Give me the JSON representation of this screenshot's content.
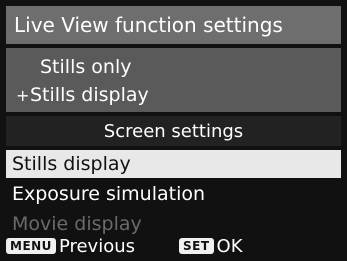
{
  "title": "Live View function settings",
  "options": {
    "line1": "Stills only",
    "line2": "Stills display",
    "cursor_glyph": "+"
  },
  "screen_settings": {
    "header": "Screen settings",
    "items": [
      {
        "label": "Stills display",
        "state": "selected"
      },
      {
        "label": "Exposure simulation",
        "state": "normal"
      },
      {
        "label": "Movie display",
        "state": "disabled"
      }
    ]
  },
  "footer": {
    "menu_key": "MENU",
    "menu_label": "Previous",
    "set_key": "SET",
    "set_label": "OK"
  },
  "colors": {
    "title_bg": "#6e6e6e",
    "options_bg": "#5a5a5a",
    "selected_bg": "#e8e8e8",
    "disabled_text": "#6a6a6a"
  }
}
